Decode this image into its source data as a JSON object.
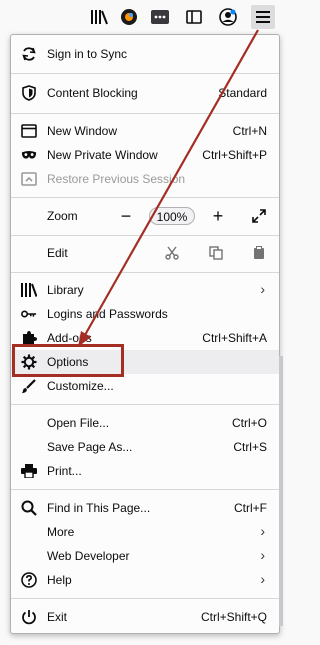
{
  "toolbar": {
    "icons": [
      "library-icon",
      "color-icon",
      "dots-icon",
      "sidebar-icon",
      "account-icon",
      "hamburger-icon"
    ]
  },
  "menu": {
    "sync": "Sign in to Sync",
    "content_blocking": "Content Blocking",
    "content_blocking_value": "Standard",
    "new_window": "New Window",
    "new_window_sc": "Ctrl+N",
    "private_window": "New Private Window",
    "private_window_sc": "Ctrl+Shift+P",
    "restore": "Restore Previous Session",
    "zoom": "Zoom",
    "zoom_minus": "−",
    "zoom_value": "100%",
    "zoom_plus": "+",
    "edit": "Edit",
    "library": "Library",
    "logins": "Logins and Passwords",
    "addons": "Add-ons",
    "addons_sc": "Ctrl+Shift+A",
    "options": "Options",
    "customize": "Customize...",
    "open_file": "Open File...",
    "open_file_sc": "Ctrl+O",
    "save_page": "Save Page As...",
    "save_page_sc": "Ctrl+S",
    "print": "Print...",
    "find": "Find in This Page...",
    "find_sc": "Ctrl+F",
    "more": "More",
    "web_dev": "Web Developer",
    "help": "Help",
    "exit": "Exit",
    "exit_sc": "Ctrl+Shift+Q",
    "chevron": "›"
  },
  "colors": {
    "annotation": "#a42e24",
    "highlight_row": "#ededf0"
  }
}
